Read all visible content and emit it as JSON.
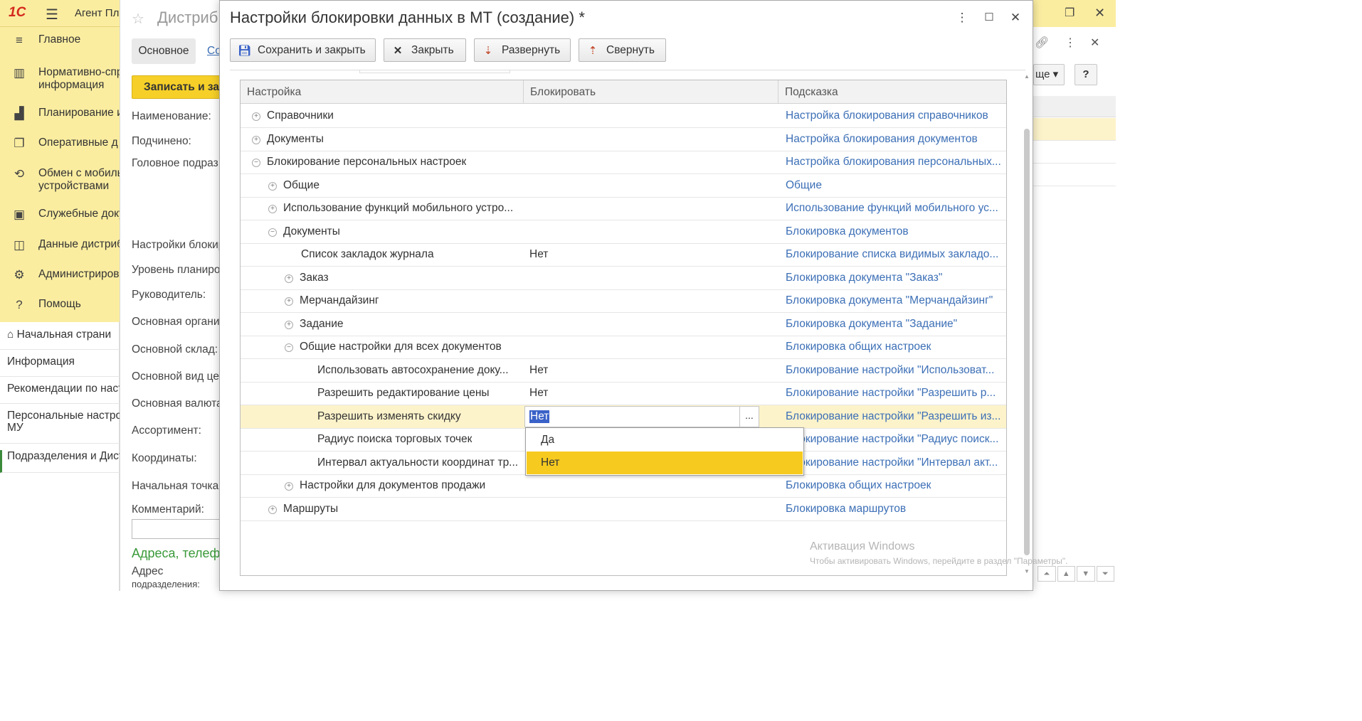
{
  "app": {
    "title": "Агент Пл",
    "logo": "1С"
  },
  "sidebar": {
    "items": [
      {
        "icon": "≡",
        "label": "Главное"
      },
      {
        "icon": "▥",
        "label": "Нормативно-спр\nинформация"
      },
      {
        "icon": "▟",
        "label": "Планирование и"
      },
      {
        "icon": "❐",
        "label": "Оперативные д"
      },
      {
        "icon": "⟲",
        "label": "Обмен с мобиль\nустройствами"
      },
      {
        "icon": "▣",
        "label": "Служебные доку"
      },
      {
        "icon": "◫",
        "label": "Данные дистриб"
      },
      {
        "icon": "⚙",
        "label": "Администриров"
      },
      {
        "icon": "?",
        "label": "Помощь"
      }
    ]
  },
  "open_windows": [
    {
      "label": "Начальная страни"
    },
    {
      "label": "Информация"
    },
    {
      "label": "Рекомендации по наст"
    },
    {
      "label": "Персональные настро\nМУ"
    },
    {
      "label": "Подразделения и Дист"
    }
  ],
  "bg_form": {
    "title": "Дистриб",
    "tab": "Основное",
    "tab2": "Со",
    "write_button": "Записать и за",
    "fields": [
      "Наименование:",
      "Подчинено:",
      "Головное подраз",
      "Настройки блокир",
      "Уровень планиро",
      "Руководитель:",
      "Основная органи",
      "Основной склад:",
      "Основной вид це",
      "Основная валюта",
      "Ассортимент:",
      "Координаты:",
      "Начальная точка",
      "Комментарий:"
    ],
    "section": "Адреса, телеф",
    "address_label": "Адрес",
    "address_sub": "подразделения:"
  },
  "right": {
    "more_button": "ще",
    "help_button": "?"
  },
  "dialog": {
    "title": "Настройки блокировки данных в МТ (создание) *",
    "buttons": {
      "save_close": "Сохранить и закрыть",
      "close": "Закрыть",
      "expand": "Развернуть",
      "collapse": "Свернуть"
    },
    "columns": {
      "setting": "Настройка",
      "block": "Блокировать",
      "hint": "Подсказка"
    },
    "rows": [
      {
        "level": 0,
        "toggle": "+",
        "name": "Справочники",
        "value": "",
        "hint": "Настройка блокирования справочников"
      },
      {
        "level": 0,
        "toggle": "+",
        "name": "Документы",
        "value": "",
        "hint": "Настройка блокирования документов"
      },
      {
        "level": 0,
        "toggle": "−",
        "name": "Блокирование персональных настроек",
        "value": "",
        "hint": "Настройка блокирования персональных..."
      },
      {
        "level": 1,
        "toggle": "+",
        "name": "Общие",
        "value": "",
        "hint": "Общие"
      },
      {
        "level": 1,
        "toggle": "+",
        "name": "Использование функций мобильного устро...",
        "value": "",
        "hint": "Использование функций мобильного ус..."
      },
      {
        "level": 1,
        "toggle": "−",
        "name": "Документы",
        "value": "",
        "hint": "Блокировка документов"
      },
      {
        "level": 2,
        "toggle": "",
        "name": "Список закладок журнала",
        "value": "Нет",
        "hint": "Блокирование списка видимых закладо..."
      },
      {
        "level": 2,
        "toggle": "+",
        "name": "Заказ",
        "value": "",
        "hint": "Блокировка документа \"Заказ\""
      },
      {
        "level": 2,
        "toggle": "+",
        "name": "Мерчандайзинг",
        "value": "",
        "hint": "Блокировка документа \"Мерчандайзинг\""
      },
      {
        "level": 2,
        "toggle": "+",
        "name": "Задание",
        "value": "",
        "hint": "Блокировка документа \"Задание\""
      },
      {
        "level": 2,
        "toggle": "−",
        "name": "Общие настройки для всех документов",
        "value": "",
        "hint": "Блокировка общих настроек"
      },
      {
        "level": 3,
        "toggle": "",
        "name": "Использовать автосохранение доку...",
        "value": "Нет",
        "hint": "Блокирование настройки \"Использоват..."
      },
      {
        "level": 3,
        "toggle": "",
        "name": "Разрешить редактирование цены",
        "value": "Нет",
        "hint": "Блокирование настройки \"Разрешить р..."
      },
      {
        "level": 3,
        "toggle": "",
        "name": "Разрешить изменять скидку",
        "value": "Нет",
        "hint": "Блокирование настройки \"Разрешить из...",
        "selected": true
      },
      {
        "level": 3,
        "toggle": "",
        "name": "Радиус поиска торговых точек",
        "value": "",
        "hint": "Блокирование настройки \"Радиус поиск..."
      },
      {
        "level": 3,
        "toggle": "",
        "name": "Интервал актуальности координат тр...",
        "value": "",
        "hint": "Блокирование настройки \"Интервал акт..."
      },
      {
        "level": 2,
        "toggle": "+",
        "name": "Настройки для документов продажи",
        "value": "",
        "hint": "Блокировка общих настроек"
      },
      {
        "level": 1,
        "toggle": "+",
        "name": "Маршруты",
        "value": "",
        "hint": "Блокировка маршрутов"
      }
    ],
    "editor": {
      "value": "Нет",
      "button": "..."
    },
    "dropdown": {
      "options": [
        "Да",
        "Нет"
      ],
      "selected": "Нет"
    }
  },
  "watermark": {
    "line1": "Активация Windows",
    "line2": "Чтобы активировать Windows, перейдите в раздел \"Параметры\"."
  }
}
